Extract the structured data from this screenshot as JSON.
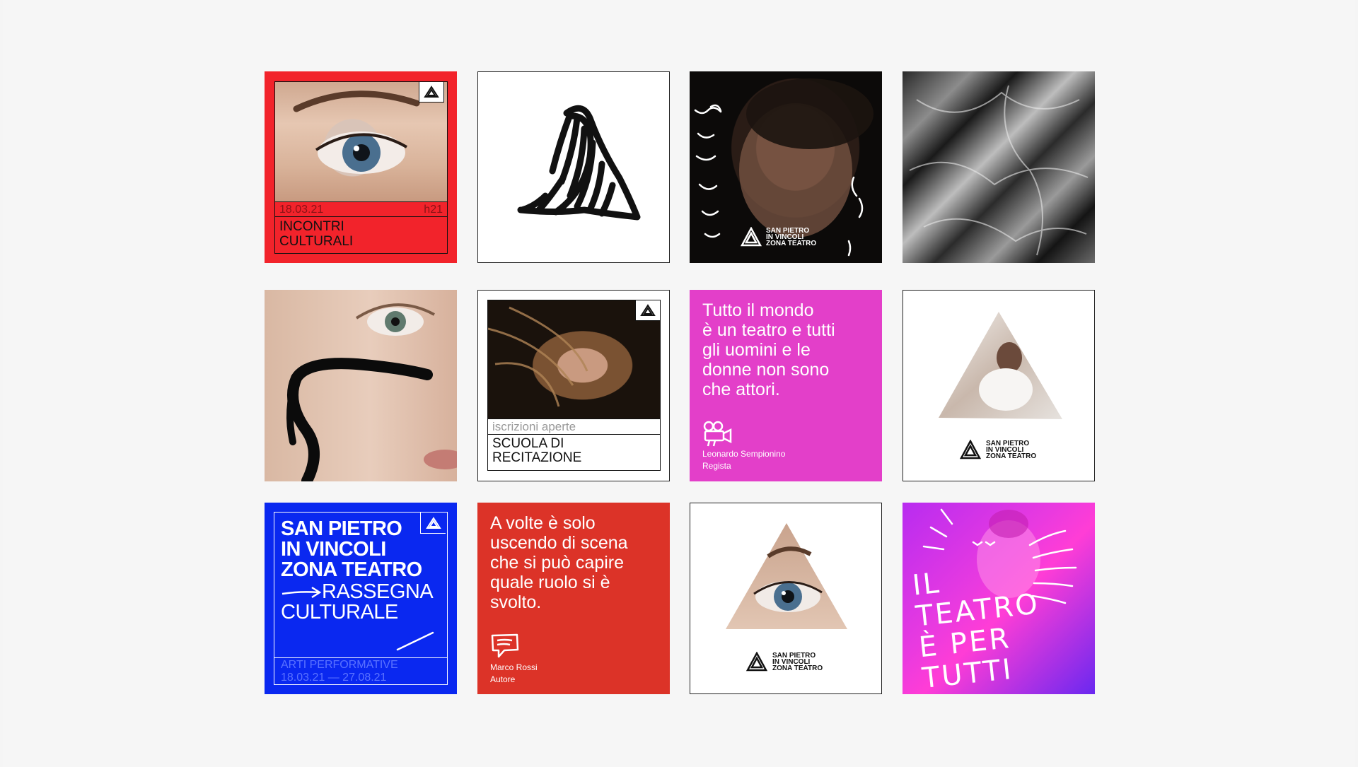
{
  "tiles": {
    "incontri": {
      "date": "18.03.21",
      "time": "h21",
      "title_line1": "INCONTRI",
      "title_line2": "CULTURALI"
    },
    "actor_photo": {
      "brand_line1": "SAN PIETRO",
      "brand_line2": "IN VINCOLI",
      "brand_line3": "ZONA TEATRO"
    },
    "scuola": {
      "caption": "iscrizioni aperte",
      "title_line1": "SCUOLA DI",
      "title_line2": "RECITAZIONE"
    },
    "quote_pink": {
      "lines": [
        "Tutto il mondo",
        "è un teatro e tutti",
        "gli uomini e le",
        "donne non sono",
        "che attori."
      ],
      "author": "Leonardo Sempionino",
      "role": "Regista",
      "color": "#e33fc9"
    },
    "triangle_woman": {
      "brand_line1": "SAN PIETRO",
      "brand_line2": "IN VINCOLI",
      "brand_line3": "ZONA TEATRO"
    },
    "rassegna": {
      "line1": "SAN PIETRO",
      "line2": "IN VINCOLI",
      "line3": "ZONA TEATRO",
      "line4": "RASSEGNA",
      "line5": "CULTURALE",
      "subtitle": "ARTI PERFORMATIVE",
      "dates": "18.03.21 — 27.08.21",
      "color": "#0a28f0"
    },
    "quote_red": {
      "lines": [
        "A volte è solo",
        "uscendo di scena",
        "che si può capire",
        "quale ruolo si è",
        "svolto."
      ],
      "author": "Marco Rossi",
      "role": "Autore",
      "color": "#dc3328"
    },
    "triangle_eye": {
      "brand_line1": "SAN PIETRO",
      "brand_line2": "IN VINCOLI",
      "brand_line3": "ZONA TEATRO"
    },
    "teatro_per_tutti": {
      "line1": "IL",
      "line2": "TEATRO",
      "line3": "È PER",
      "line4": "TUTTI"
    }
  },
  "icons": [
    "triangle-logo-icon",
    "camera-icon",
    "speech-bubble-icon",
    "arrow-icon"
  ]
}
